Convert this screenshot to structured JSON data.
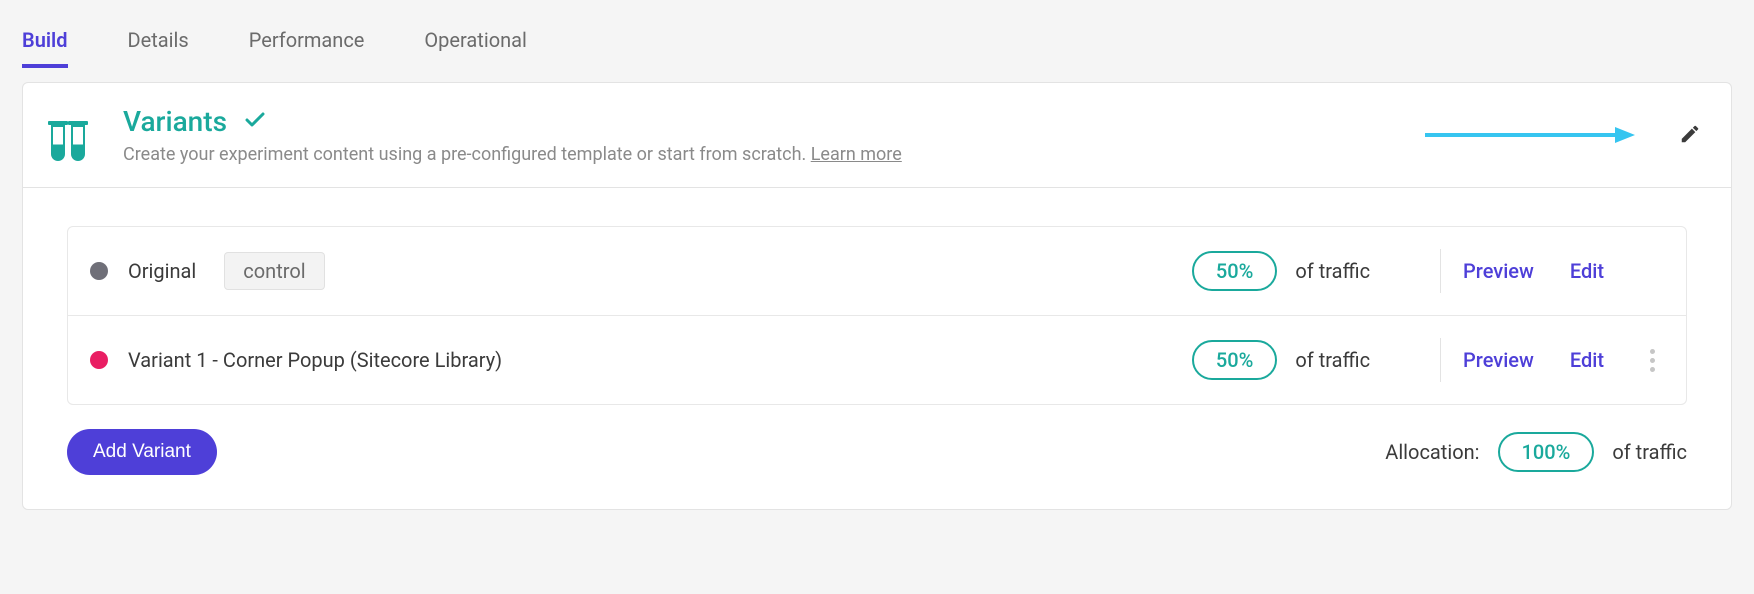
{
  "tabs": {
    "build": "Build",
    "details": "Details",
    "performance": "Performance",
    "operational": "Operational"
  },
  "header": {
    "title": "Variants",
    "subtitle_pre": "Create your experiment content using a pre-configured template or start from scratch. ",
    "learn_more": "Learn more"
  },
  "variants": [
    {
      "name": "Original",
      "dot_color": "#6f6f78",
      "control_label": "control",
      "percent": "50%",
      "of_traffic": "of traffic",
      "preview": "Preview",
      "edit": "Edit",
      "has_more": false
    },
    {
      "name": "Variant 1 - Corner Popup (Sitecore Library)",
      "dot_color": "#e91e63",
      "control_label": "",
      "percent": "50%",
      "of_traffic": "of traffic",
      "preview": "Preview",
      "edit": "Edit",
      "has_more": true
    }
  ],
  "footer": {
    "add_variant": "Add Variant",
    "allocation_label": "Allocation:",
    "allocation_percent": "100%",
    "of_traffic": "of traffic"
  }
}
